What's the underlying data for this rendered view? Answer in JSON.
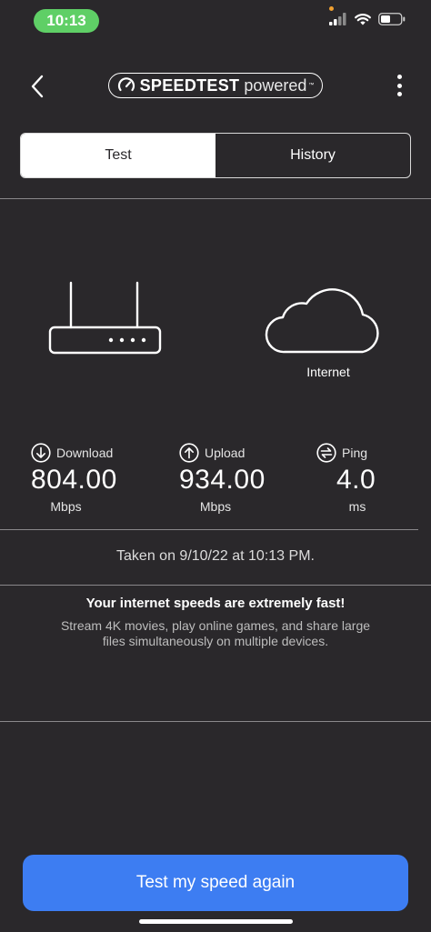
{
  "status_bar": {
    "time": "10:13"
  },
  "nav": {
    "brand_name": "SPEEDTEST",
    "brand_suffix": "powered",
    "brand_tm": "™",
    "back_icon": "chevron-left-icon",
    "more_icon": "more-vertical-icon"
  },
  "tabs": [
    {
      "label": "Test",
      "active": true
    },
    {
      "label": "History",
      "active": false
    }
  ],
  "devices": {
    "router_icon": "router-icon",
    "cloud_icon": "cloud-icon",
    "internet_label": "Internet"
  },
  "metrics": {
    "download": {
      "label": "Download",
      "value": "804.00",
      "unit": "Mbps",
      "icon": "download-arrow-icon"
    },
    "upload": {
      "label": "Upload",
      "value": "934.00",
      "unit": "Mbps",
      "icon": "upload-arrow-icon"
    },
    "ping": {
      "label": "Ping",
      "value": "4.0",
      "unit": "ms",
      "icon": "ping-icon"
    }
  },
  "result": {
    "taken": "Taken on 9/10/22 at 10:13 PM.",
    "headline": "Your internet speeds are extremely fast!",
    "description": "Stream 4K movies, play online games, and share large files simultaneously on multiple devices."
  },
  "cta": {
    "label": "Test my speed again"
  },
  "colors": {
    "background": "#2a282b",
    "accent": "#3d7df2",
    "time_pill": "#5fcf66"
  }
}
